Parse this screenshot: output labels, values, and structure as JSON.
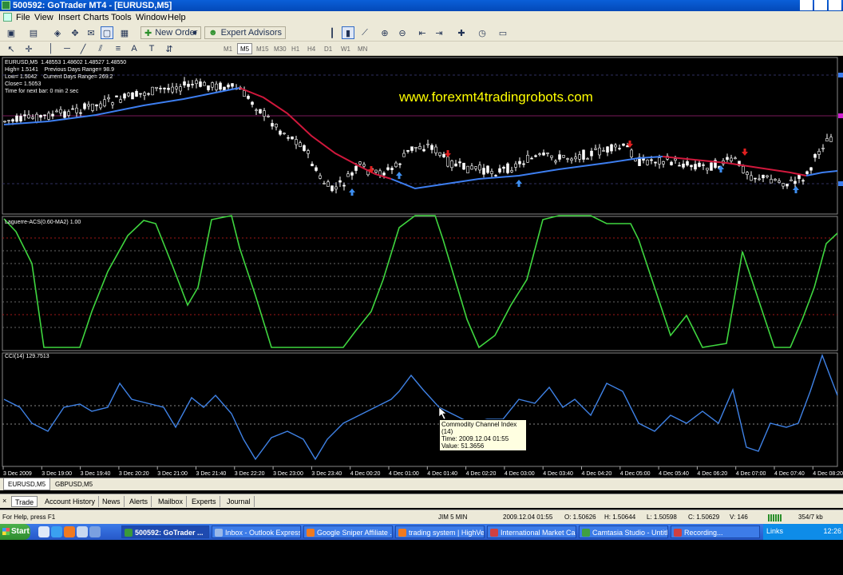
{
  "window": {
    "title": "500592: GoTrader MT4 - [EURUSD,M5]"
  },
  "menu": [
    "File",
    "View",
    "Insert",
    "Charts",
    "Tools",
    "Window",
    "Help"
  ],
  "toolbar": {
    "new_order": "New Order",
    "expert_advisors": "Expert Advisors"
  },
  "timeframes": [
    "M1",
    "M5",
    "M15",
    "M30",
    "H1",
    "H4",
    "D1",
    "W1",
    "MN"
  ],
  "active_timeframe": "M5",
  "chart": {
    "header": "EURUSD,M5  1.48553 1.48602 1.48527 1.48550",
    "info_lines": [
      "High= 1.5141    Previous Days Range= 98.9",
      "Low= 1.5042    Current Days Range= 269.2",
      "Close= 1.5053",
      "Time for next bar: 0 min 2 sec"
    ],
    "site": "www.forexmt4tradingrobots.com",
    "indicator1_label": "Laguerre-ACS(0.60-MA2) 1.00",
    "indicator2_label": "CCI(14) 129.7513",
    "time_labels": [
      "3 Dec 2009",
      "3 Dec 19:00",
      "3 Dec 19:40",
      "3 Dec 20:20",
      "3 Dec 21:00",
      "3 Dec 21:40",
      "3 Dec 22:20",
      "3 Dec 23:00",
      "3 Dec 23:40",
      "4 Dec 00:20",
      "4 Dec 01:00",
      "4 Dec 01:40",
      "4 Dec 02:20",
      "4 Dec 03:00",
      "4 Dec 03:40",
      "4 Dec 04:20",
      "4 Dec 05:00",
      "4 Dec 05:40",
      "4 Dec 06:20",
      "4 Dec 07:00",
      "4 Dec 07:40",
      "4 Dec 08:20"
    ],
    "tooltip": {
      "line1": "Commodity Channel Index (14)",
      "line2": "Time: 2009.12.04 01:55",
      "line3": "Value: 51.3656"
    },
    "colors": {
      "bull": "#ffffff",
      "ma_blue": "#3d7ef0",
      "ma_red": "#d0183c",
      "laguerre": "#3fd63f",
      "cci": "#3f82e6",
      "site": "#ffff00"
    }
  },
  "symbol_tabs": [
    "EURUSD,M5",
    "GBPUSD,M5"
  ],
  "terminal_tabs": [
    "Trade",
    "Account History",
    "News",
    "Alerts",
    "Mailbox",
    "Experts",
    "Journal"
  ],
  "status": {
    "help": "For Help, press F1",
    "profile": "JIM 5 MIN",
    "time": "2009.12.04 01:55",
    "open": "O: 1.50626",
    "high": "H: 1.50644",
    "low": "L: 1.50598",
    "close": "C: 1.50629",
    "volume": "V: 146",
    "traffic": "354/7 kb"
  },
  "taskbar": {
    "start": "Start",
    "tasks": [
      "500592: GoTrader ...",
      "Inbox - Outlook Express",
      "Google Sniper Affiliate ...",
      "trading system | HighVel...",
      "International Market Cal...",
      "Camtasia Studio - Untitl...",
      "Recording..."
    ],
    "links": "Links",
    "clock": "12:26"
  }
}
